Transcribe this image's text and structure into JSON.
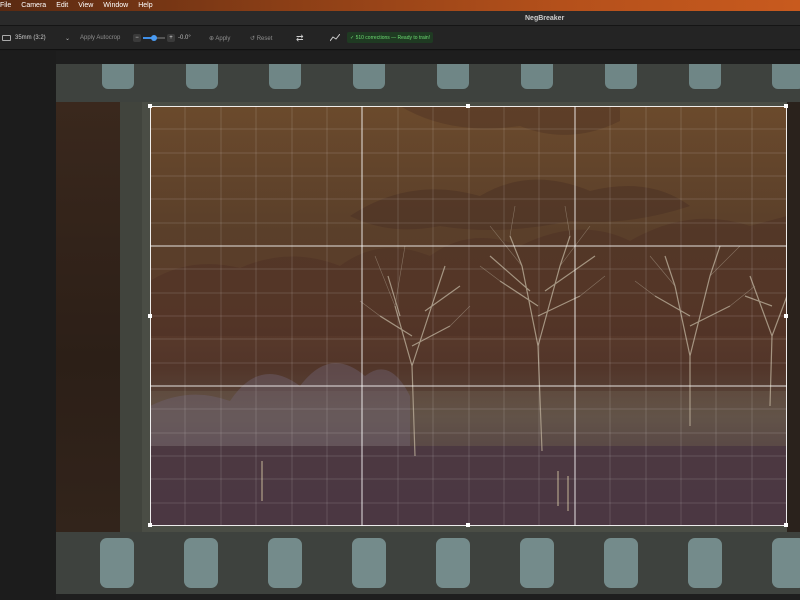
{
  "menubar": {
    "items": [
      "File",
      "Camera",
      "Edit",
      "View",
      "Window",
      "Help"
    ]
  },
  "window": {
    "title": "NegBreaker"
  },
  "toolbar": {
    "format_label": "35mm  (3:2)",
    "autocrop_label": "Apply Autocrop",
    "rotation_minus": "−",
    "rotation_plus": "+",
    "rotation_value": "-0.0°",
    "rotation_fraction": 0.5,
    "apply_label": "⊕ Apply",
    "reset_label": "↺ Reset",
    "swap_icon": "⇄",
    "chart_icon": "⌁",
    "status_text": "✓ 510 corrections — Ready to train!",
    "status_color": "#6ddc73",
    "accent_color": "#3f8fe8"
  }
}
